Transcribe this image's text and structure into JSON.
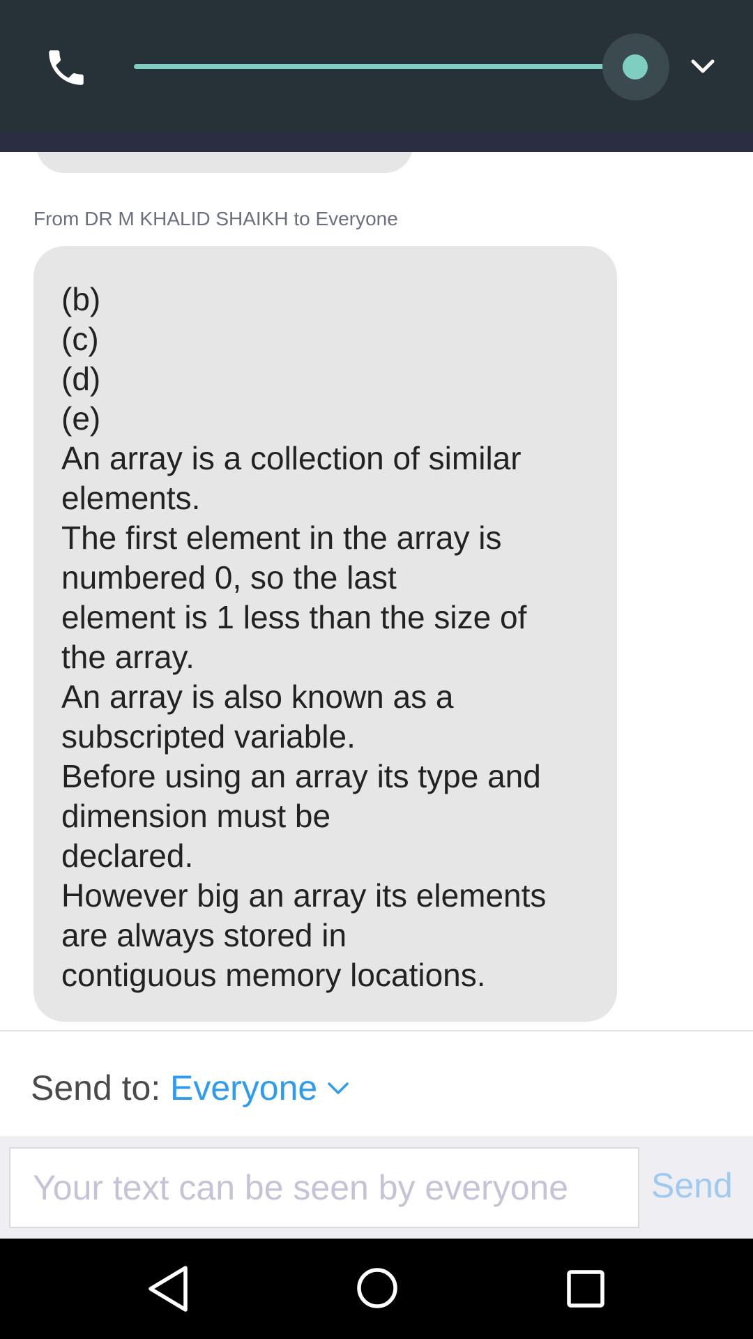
{
  "call_bar": {
    "phone_icon": "phone-icon",
    "audio_level": 1.0,
    "collapse_icon": "chevron-down-icon",
    "accent_color": "#7ecfc2",
    "background_color": "#263238"
  },
  "chat": {
    "sender_line": "From DR M KHALID SHAIKH to Everyone",
    "message_lines": [
      "(b)",
      "(c)",
      "(d)",
      "(e)",
      "An array is a collection of similar",
      "elements.",
      "The first element in the array is",
      "numbered 0, so the last",
      "element is 1 less than the size of",
      "the array.",
      "An array is also known as a",
      "subscripted variable.",
      "Before using an array its type and",
      "dimension must be",
      "declared.",
      "However big an array its elements",
      "are always stored in",
      "contiguous memory locations."
    ],
    "bubble_color": "#e6e6e6"
  },
  "send_to": {
    "label": "Send to:",
    "value": "Everyone",
    "value_color": "#2d9cf0"
  },
  "composer": {
    "placeholder": "Your text can be seen by everyone",
    "value": "",
    "send_label": "Send",
    "send_color": "#9ec9f2"
  },
  "nav_bar": {
    "back_icon": "back-icon",
    "home_icon": "home-icon",
    "recents_icon": "recents-icon"
  }
}
